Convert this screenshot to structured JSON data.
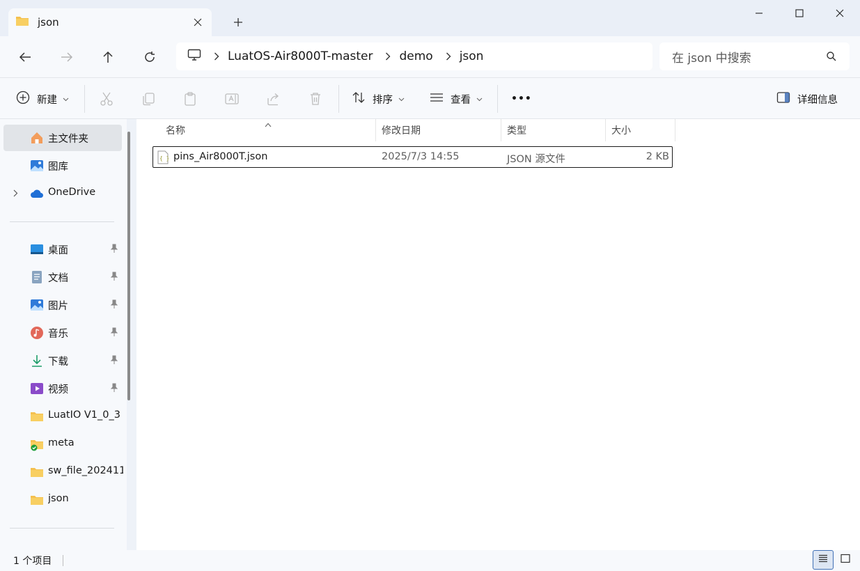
{
  "window": {
    "tab_title": "json",
    "new_tab_glyph": "+"
  },
  "address": {
    "crumbs": [
      "LuatOS-Air8000T-master",
      "demo",
      "json"
    ],
    "search_placeholder": "在 json 中搜索"
  },
  "toolbar": {
    "new_label": "新建",
    "sort_label": "排序",
    "view_label": "查看",
    "more_glyph": "•••",
    "details_label": "详细信息"
  },
  "sidebar": {
    "home": "主文件夹",
    "gallery": "图库",
    "onedrive": "OneDrive",
    "desktop": "桌面",
    "documents": "文档",
    "pictures": "图片",
    "music": "音乐",
    "downloads": "下载",
    "videos": "视频",
    "luatio": "LuatIO V1_0_3",
    "meta": "meta",
    "sw_file": "sw_file_202411",
    "json": "json"
  },
  "columns": {
    "name": "名称",
    "modified": "修改日期",
    "type": "类型",
    "size": "大小"
  },
  "file": {
    "name": "pins_Air8000T.json",
    "modified": "2025/7/3 14:55",
    "type": "JSON 源文件",
    "size": "2 KB"
  },
  "status": {
    "item_count": "1 个项目"
  },
  "colors": {
    "folder": "#f4c04e",
    "accent": "#3f6fb5",
    "onedrive": "#1f6fd6"
  }
}
